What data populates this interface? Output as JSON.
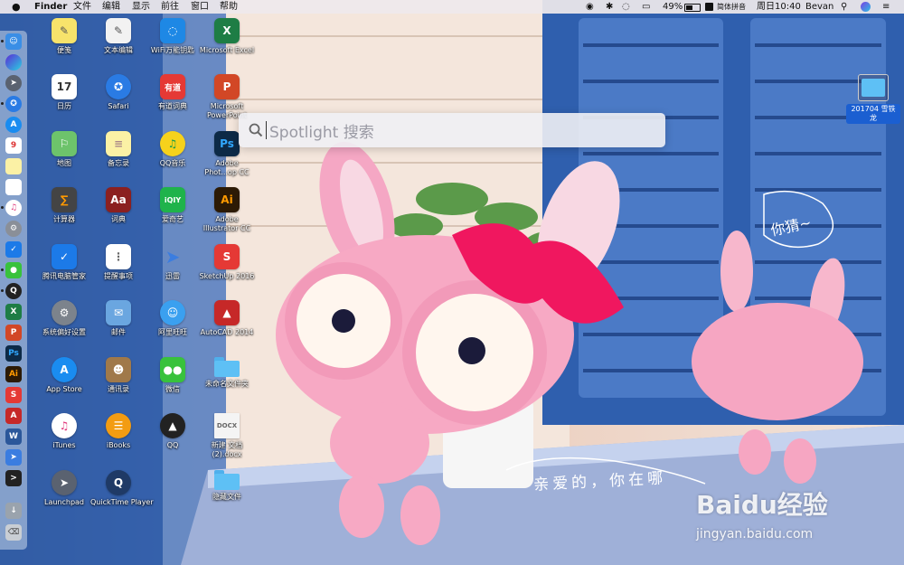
{
  "menubar": {
    "apple_icon": "apple-icon",
    "app_name": "Finder",
    "menus": [
      "文件",
      "编辑",
      "显示",
      "前往",
      "窗口",
      "帮助"
    ],
    "battery": "49%",
    "input_method": "简体拼音",
    "clock": "周日10:40",
    "user": "Bevan"
  },
  "spotlight": {
    "placeholder": "Spotlight 搜索"
  },
  "desktop_icons": {
    "col1": [
      "便笺",
      "日历",
      "地图",
      "计算器",
      "腾讯电脑管家",
      "系统偏好设置",
      "App Store",
      "iTunes",
      "Launchpad"
    ],
    "col2": [
      "文本编辑",
      "Safari",
      "备忘录",
      "词典",
      "提醒事项",
      "邮件",
      "通讯录",
      "iBooks",
      "QuickTime Player"
    ],
    "col3": [
      "WiFi万能钥匙",
      "有道词典",
      "QQ音乐",
      "爱奇艺",
      "迅雷",
      "阿里旺旺",
      "微信",
      "QQ"
    ],
    "col4": [
      "Microsoft Excel",
      "Microsoft PowerPoint",
      "Adobe Phot...op CC",
      "Adobe Illustrator CC",
      "SketchUp 2016",
      "AutoCAD 2014",
      "未命名文件夹",
      "新建 文档 (2).docx",
      "隐藏文件"
    ],
    "right_folder": "201704 雪铁龙"
  },
  "wallpaper_text": {
    "bubble": "你猜~",
    "caption": "亲爱的，你在哪",
    "watermark": "Baidu经验",
    "watermark_url": "jingyan.baidu.com"
  },
  "colors": {
    "spotlight_bg": "#f0f0f4",
    "dock_bg": "#c8d7eb"
  }
}
